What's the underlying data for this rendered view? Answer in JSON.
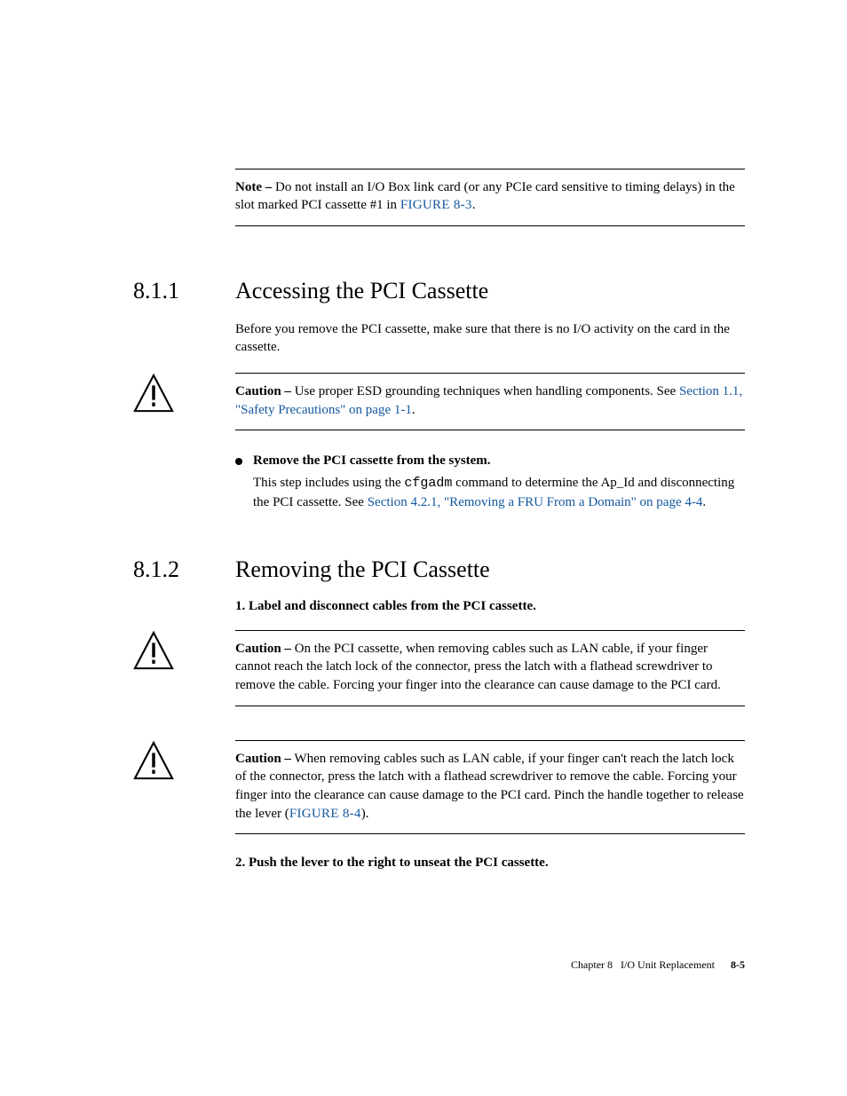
{
  "note": {
    "label": "Note –",
    "text_a": " Do not install an I/O Box link card (or any PCIe card sensitive to timing delays) in the slot marked PCI cassette #1 in ",
    "link": "FIGURE 8-3",
    "text_b": "."
  },
  "section1": {
    "num": "8.1.1",
    "title": "Accessing the PCI Cassette",
    "intro": "Before you remove the PCI cassette, make sure that there is no I/O activity on the card in the cassette."
  },
  "caution1": {
    "label": "Caution –",
    "text_a": " Use proper ESD grounding techniques when handling components. See ",
    "link": "Section 1.1, \"Safety Precautions\" on page 1-1",
    "text_b": "."
  },
  "bullet": {
    "title": "Remove the PCI cassette from the system.",
    "body_a": "This step includes using the ",
    "code": "cfgadm",
    "body_b": " command to determine the Ap_Id and disconnecting the PCI cassette. See ",
    "link": "Section 4.2.1, \"Removing a FRU From a Domain\" on page 4-4",
    "body_c": "."
  },
  "section2": {
    "num": "8.1.2",
    "title": "Removing the PCI Cassette"
  },
  "step1": "1. Label and disconnect cables from the PCI cassette.",
  "caution2": {
    "label": "Caution –",
    "text": " On the PCI cassette, when removing cables such as LAN cable, if your finger cannot reach the latch lock of the connector, press the latch with a flathead screwdriver to remove the cable. Forcing your finger into the clearance can cause damage to the PCI card."
  },
  "caution3": {
    "label": "Caution –",
    "text_a": " When removing cables such as LAN cable, if your finger can't reach the latch lock of the connector, press the latch with a flathead screwdriver to remove the cable. Forcing your finger into the clearance can cause damage to the PCI card. Pinch the handle together to release the lever (",
    "link": "FIGURE 8-4",
    "text_b": ")."
  },
  "step2": "2. Push the lever to the right to unseat the PCI cassette.",
  "footer": {
    "chapter": "Chapter 8",
    "title": "I/O Unit Replacement",
    "page": "8-5"
  }
}
